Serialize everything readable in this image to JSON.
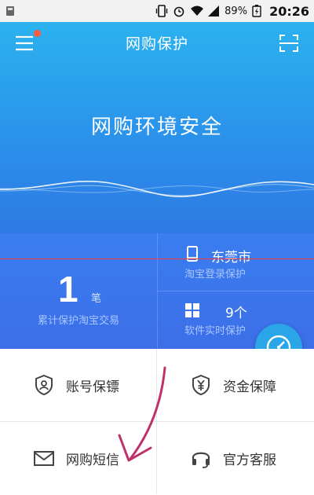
{
  "status_bar": {
    "battery": "89%",
    "time": "20:26"
  },
  "header": {
    "title": "网购保护",
    "icons": [
      "menu-icon",
      "scan-icon"
    ]
  },
  "hero": {
    "status": "网购环境安全"
  },
  "stats": {
    "trade_count": "1",
    "trade_unit": "笔",
    "trade_label": "累计保护淘宝交易",
    "login": {
      "value": "东莞市",
      "label": "淘宝登录保护",
      "icon": "phone-icon"
    },
    "software": {
      "value": "9个",
      "label": "软件实时保护",
      "icon": "windows-icon"
    }
  },
  "grid": [
    {
      "label": "账号保镖",
      "icon": "user-shield-icon"
    },
    {
      "label": "资金保障",
      "icon": "yen-shield-icon"
    },
    {
      "label": "网购短信",
      "icon": "mail-icon"
    },
    {
      "label": "官方客服",
      "icon": "headset-icon"
    }
  ],
  "colors": {
    "hero_top": "#2bb2f0",
    "hero_bottom": "#2f7ae3",
    "stats_bg": "#3c6ee8",
    "fab": "#2aa6e8",
    "arrow": "#c0306a",
    "notification_dot": "#ff5a3c"
  }
}
